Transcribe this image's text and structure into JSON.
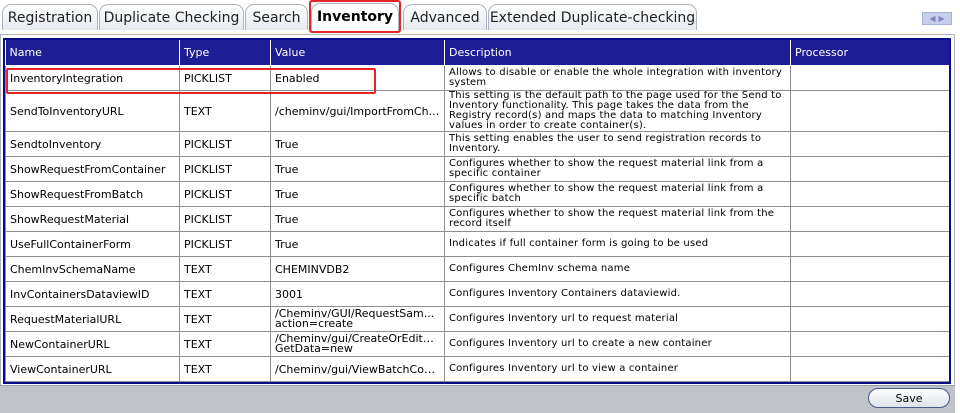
{
  "tabs": [
    {
      "label": "Registration"
    },
    {
      "label": "Duplicate Checking"
    },
    {
      "label": "Search"
    },
    {
      "label": "Inventory",
      "active": true
    },
    {
      "label": "Advanced"
    },
    {
      "label": "Extended Duplicate-checking"
    }
  ],
  "grid": {
    "headers": {
      "name": "Name",
      "type": "Type",
      "value": "Value",
      "description": "Description",
      "processor": "Processor"
    },
    "rows": [
      {
        "name": "InventoryIntegration",
        "type": "PICKLIST",
        "value": "Enabled",
        "description": "Allows to disable or enable the whole integration with inventory system",
        "processor": ""
      },
      {
        "name": "SendToInventoryURL",
        "type": "TEXT",
        "value": "/cheminv/gui/ImportFromCh...",
        "description": "This setting is the default path to the page used for the Send to Inventory functionality. This page takes the data from the Registry record(s) and maps the data to matching Inventory values in order to create container(s).",
        "processor": ""
      },
      {
        "name": "SendtoInventory",
        "type": "PICKLIST",
        "value": "True",
        "description": "This setting enables the user to send registration records to Inventory.",
        "processor": ""
      },
      {
        "name": "ShowRequestFromContainer",
        "type": "PICKLIST",
        "value": "True",
        "description": "Configures whether to show the request material link from a specific container",
        "processor": ""
      },
      {
        "name": "ShowRequestFromBatch",
        "type": "PICKLIST",
        "value": "True",
        "description": "Configures whether to show the request material link from a specific batch",
        "processor": ""
      },
      {
        "name": "ShowRequestMaterial",
        "type": "PICKLIST",
        "value": "True",
        "description": "Configures whether to show the request material link from the record itself",
        "processor": ""
      },
      {
        "name": "UseFullContainerForm",
        "type": "PICKLIST",
        "value": "True",
        "description": "Indicates if full container form is going to be used",
        "processor": ""
      },
      {
        "name": "ChemInvSchemaName",
        "type": "TEXT",
        "value": "CHEMINVDB2",
        "description": "Configures ChemInv schema name",
        "processor": ""
      },
      {
        "name": "InvContainersDataviewID",
        "type": "TEXT",
        "value": "3001",
        "description": "Configures Inventory Containers dataviewid.",
        "processor": ""
      },
      {
        "name": "RequestMaterialURL",
        "type": "TEXT",
        "value": "/Cheminv/GUI/RequestSam... action=create",
        "description": "Configures Inventory url to request material",
        "processor": ""
      },
      {
        "name": "NewContainerURL",
        "type": "TEXT",
        "value": "/Cheminv/gui/CreateOrEditC... GetData=new",
        "description": "Configures Inventory url to create a new container",
        "processor": ""
      },
      {
        "name": "ViewContainerURL",
        "type": "TEXT",
        "value": "/Cheminv/gui/ViewBatchCon...",
        "description": "Configures Inventory url to view a container",
        "processor": ""
      }
    ]
  },
  "footer": {
    "save_label": "Save"
  }
}
